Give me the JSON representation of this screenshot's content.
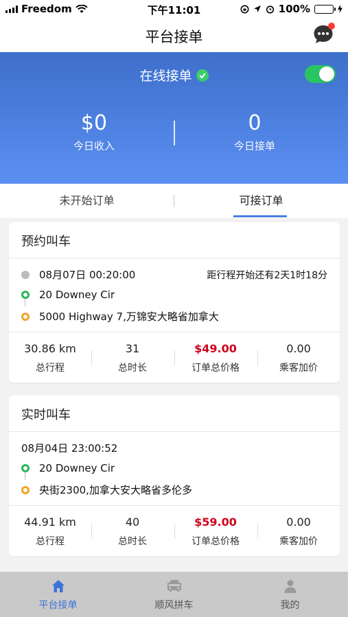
{
  "status": {
    "carrier": "Freedom",
    "time": "下午11:01",
    "battery": "100%"
  },
  "nav": {
    "title": "平台接单"
  },
  "hero": {
    "online_label": "在线接单",
    "income_value": "$0",
    "income_label": "今日收入",
    "orders_value": "0",
    "orders_label": "今日接单"
  },
  "tabs": [
    {
      "label": "未开始订单"
    },
    {
      "label": "可接订单"
    }
  ],
  "cards": [
    {
      "title": "预约叫车",
      "datetime": "08月07日 00:20:00",
      "countdown": "距行程开始还有2天1时18分",
      "from": "20 Downey Cir",
      "to": "5000 Highway 7,万锦安大略省加拿大",
      "distance": "30.86 km",
      "distance_label": "总行程",
      "duration": "31",
      "duration_label": "总时长",
      "price": "$49.00",
      "price_label": "订单总价格",
      "extra": "0.00",
      "extra_label": "乘客加价"
    },
    {
      "title": "实时叫车",
      "datetime": "08月04日 23:00:52",
      "from": "20 Downey Cir",
      "to": "央街2300,加拿大安大略省多伦多",
      "distance": "44.91 km",
      "distance_label": "总行程",
      "duration": "40",
      "duration_label": "总时长",
      "price": "$59.00",
      "price_label": "订单总价格",
      "extra": "0.00",
      "extra_label": "乘客加价"
    }
  ],
  "tabbar": [
    {
      "label": "平台接单",
      "icon": "home-icon"
    },
    {
      "label": "顺风拼车",
      "icon": "car-icon"
    },
    {
      "label": "我的",
      "icon": "person-icon"
    }
  ],
  "colors": {
    "accent": "#3d73d9",
    "price": "#d0021b",
    "toggle_on": "#29c564"
  }
}
